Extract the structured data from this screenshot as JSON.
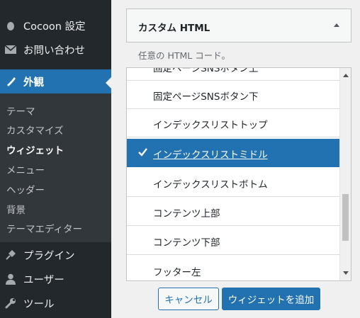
{
  "sidebar": {
    "items": [
      {
        "label": "Cocoon 設定",
        "icon": "cocoon-icon"
      },
      {
        "label": "お問い合わせ",
        "icon": "mail-icon"
      },
      {
        "label": "外観",
        "icon": "paintbrush-icon"
      },
      {
        "label": "プラグイン",
        "icon": "plugin-icon"
      },
      {
        "label": "ユーザー",
        "icon": "user-icon"
      },
      {
        "label": "ツール",
        "icon": "wrench-icon"
      }
    ],
    "submenu": [
      "テーマ",
      "カスタマイズ",
      "ウィジェット",
      "メニュー",
      "ヘッダー",
      "背景",
      "テーマエディター"
    ],
    "submenu_current": "ウィジェット"
  },
  "widget": {
    "title": "カスタム HTML",
    "description": "任意の HTML コード。"
  },
  "area_list": {
    "items": [
      "固定ページSNSボタン上",
      "固定ページSNSボタン下",
      "インデックスリストトップ",
      "インデックスリストミドル",
      "インデックスリストボトム",
      "コンテンツ上部",
      "コンテンツ下部",
      "フッター左"
    ],
    "selected": "インデックスリストミドル"
  },
  "buttons": {
    "cancel": "キャンセル",
    "add": "ウィジェットを追加"
  },
  "colors": {
    "sidebar_bg": "#23282d",
    "submenu_bg": "#32373c",
    "accent": "#2271b1"
  }
}
